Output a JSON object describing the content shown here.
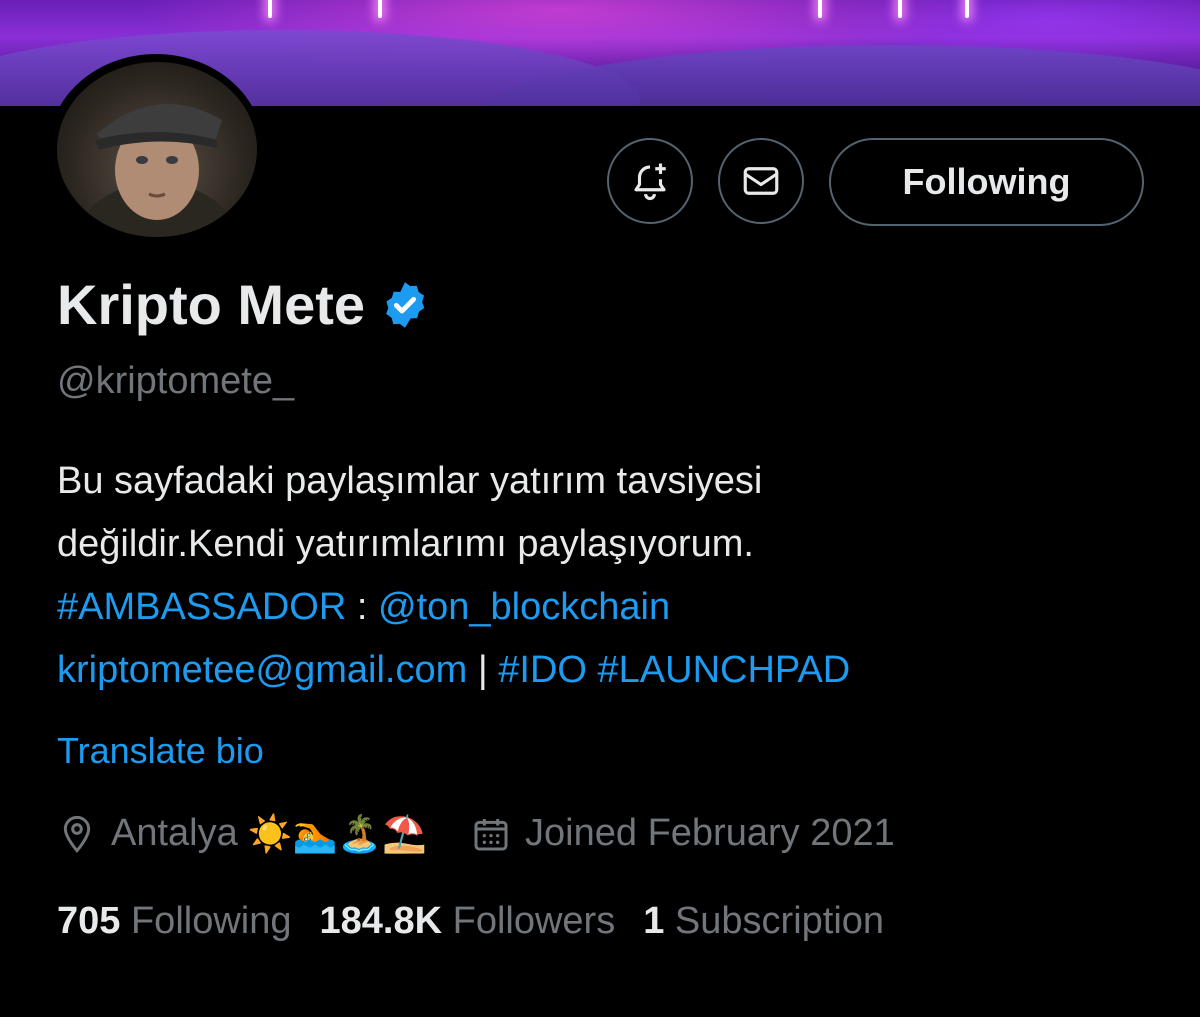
{
  "profile": {
    "name": "Kripto Mete",
    "handle": "@kriptomete_",
    "bio_line1": "Bu sayfadaki paylaşımlar yatırım tavsiyesi",
    "bio_line2": "değildir.Kendi yatırımlarımı paylaşıyorum.",
    "bio_hashtag_ambassador": "#AMBASSADOR",
    "bio_colon": " : ",
    "bio_mention": "@ton_blockchain",
    "bio_email": "kriptometee@gmail.com",
    "bio_sep": " | ",
    "bio_hashtag_ido": "#IDO",
    "bio_hashtag_launchpad": "#LAUNCHPAD",
    "translate_label": "Translate bio",
    "location": "Antalya",
    "location_emoji": "☀️🏊🏝️⛱️",
    "joined": "Joined February 2021"
  },
  "actions": {
    "follow_label": "Following"
  },
  "stats": {
    "following_count": "705",
    "following_label": "Following",
    "followers_count": "184.8K",
    "followers_label": "Followers",
    "subscription_count": "1",
    "subscription_label": "Subscription"
  },
  "colors": {
    "accent": "#1d9bf0",
    "muted": "#71767b",
    "text": "#e7e9ea",
    "background": "#000000"
  }
}
